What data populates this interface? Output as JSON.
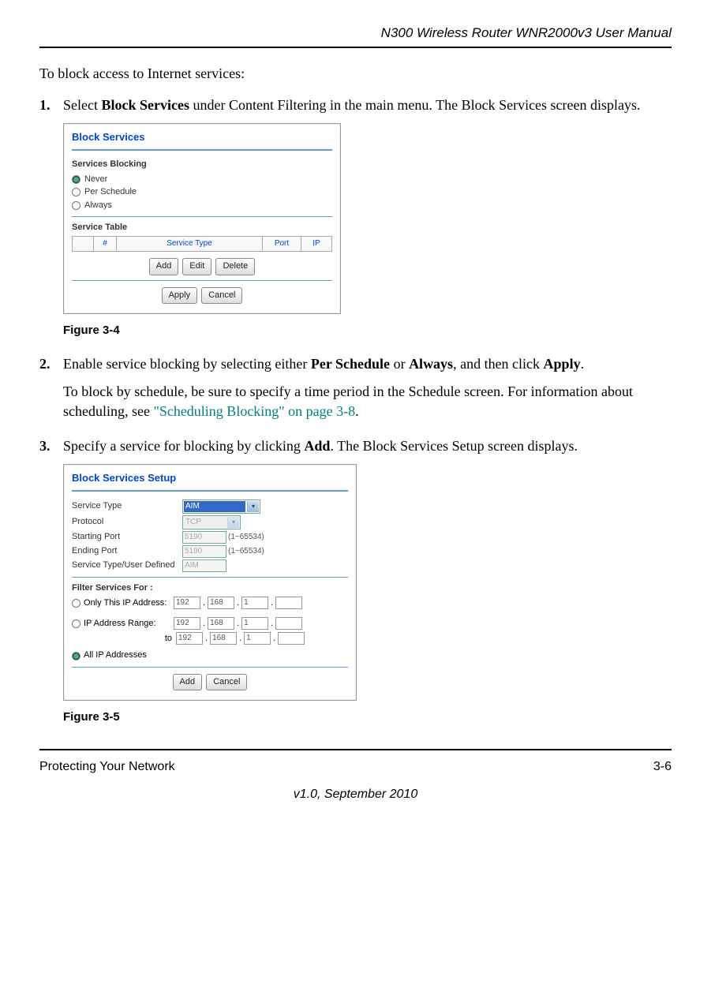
{
  "header": {
    "product": "N300 Wireless Router WNR2000v3 User Manual"
  },
  "intro": "To block access to Internet services:",
  "steps": {
    "s1_num": "1.",
    "s1_a": "Select ",
    "s1_bold": "Block Services",
    "s1_b": " under Content Filtering in the main menu. The Block Services screen displays.",
    "s2_num": "2.",
    "s2_a": "Enable service blocking by selecting either ",
    "s2_b1": "Per Schedule",
    "s2_mid": " or ",
    "s2_b2": "Always",
    "s2_c": ", and then click ",
    "s2_b3": "Apply",
    "s2_end": ".",
    "s2_p2a": "To block by schedule, be sure to specify a time period in the Schedule screen. For information about scheduling, see ",
    "s2_link": "\"Scheduling Blocking\" on page 3-8",
    "s2_p2b": ".",
    "s3_num": "3.",
    "s3_a": "Specify a service for blocking by clicking ",
    "s3_b": "Add",
    "s3_c": ". The Block Services Setup screen displays."
  },
  "fig1": {
    "caption": "Figure 3-4",
    "title": "Block Services",
    "services_blocking": "Services Blocking",
    "never": "Never",
    "per_schedule": "Per Schedule",
    "always": "Always",
    "service_table": "Service Table",
    "col_hash": "#",
    "col_type": "Service Type",
    "col_port": "Port",
    "col_ip": "IP",
    "add": "Add",
    "edit": "Edit",
    "delete": "Delete",
    "apply": "Apply",
    "cancel": "Cancel"
  },
  "fig2": {
    "caption": "Figure 3-5",
    "title": "Block Services Setup",
    "service_type": "Service Type",
    "service_type_val": "AIM",
    "protocol": "Protocol",
    "protocol_val": "TCP",
    "starting_port": "Starting Port",
    "starting_port_val": "5190",
    "ending_port": "Ending Port",
    "ending_port_val": "5190",
    "port_range": "(1~65534)",
    "user_defined": "Service Type/User Defined",
    "user_defined_val": "AIM",
    "filter_for": "Filter Services For :",
    "only_ip": "Only This IP Address:",
    "ip_range": "IP Address Range:",
    "to": "to",
    "all_ip": "All IP Addresses",
    "ip1": "192",
    "ip2": "168",
    "ip3": "1",
    "add": "Add",
    "cancel": "Cancel"
  },
  "footer": {
    "left": "Protecting Your Network",
    "right": "3-6",
    "center": "v1.0, September 2010"
  }
}
